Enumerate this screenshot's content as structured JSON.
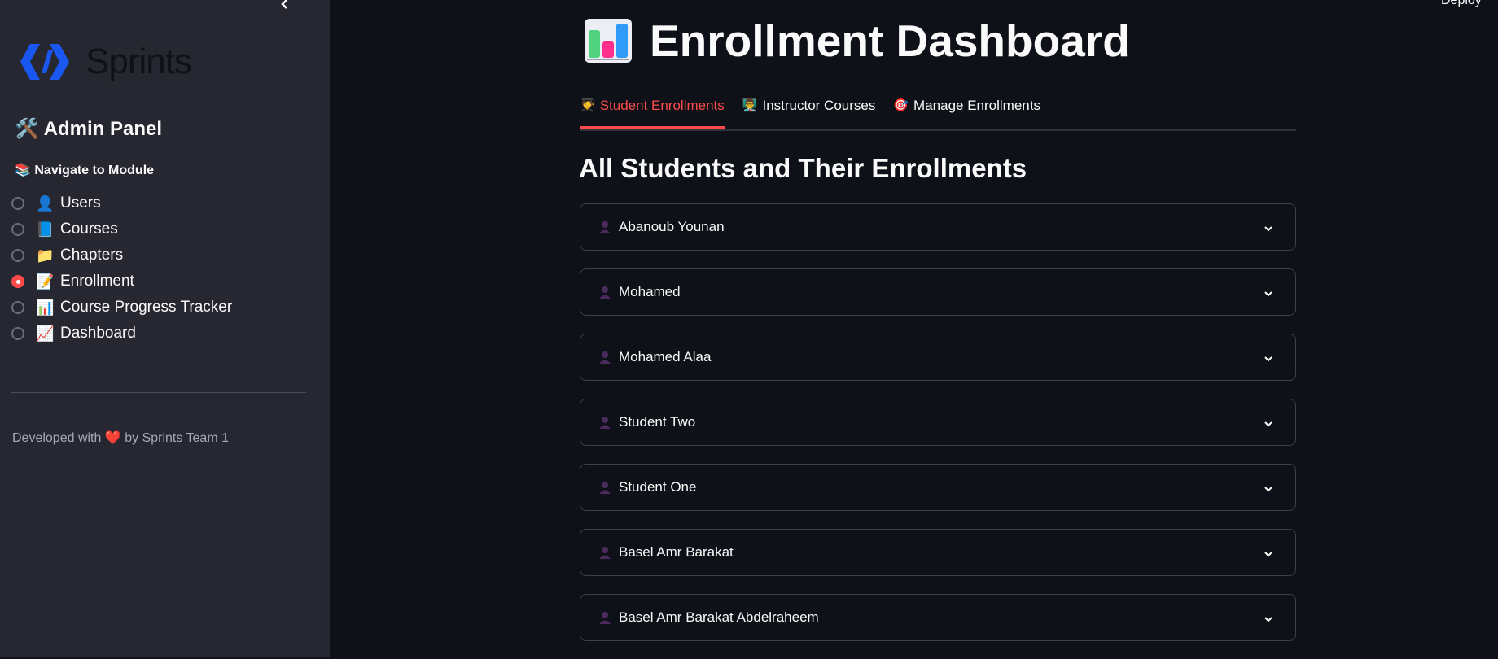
{
  "sidebar": {
    "collapse_icon": "chevron-left-icon",
    "logo_text": "Sprints",
    "panel_title": "🛠️ Admin Panel",
    "nav_label": "📚 Navigate to Module",
    "items": [
      {
        "emoji": "👤",
        "label": "Users",
        "selected": false
      },
      {
        "emoji": "📘",
        "label": "Courses",
        "selected": false
      },
      {
        "emoji": "📁",
        "label": "Chapters",
        "selected": false
      },
      {
        "emoji": "📝",
        "label": "Enrollment",
        "selected": true
      },
      {
        "emoji": "📊",
        "label": "Course Progress Tracker",
        "selected": false
      },
      {
        "emoji": "📈",
        "label": "Dashboard",
        "selected": false
      }
    ],
    "footer_prefix": "Developed with",
    "footer_heart": "❤️",
    "footer_suffix": "by Sprints Team 1"
  },
  "header": {
    "deploy_label": "Deploy"
  },
  "main": {
    "title_icon": "bar-chart-icon",
    "title": "Enrollment Dashboard",
    "tabs": [
      {
        "emoji": "🧑‍🎓",
        "label": "Student Enrollments",
        "active": true
      },
      {
        "emoji": "👨‍🏫",
        "label": "Instructor Courses",
        "active": false
      },
      {
        "emoji": "🎯",
        "label": "Manage Enrollments",
        "active": false
      }
    ],
    "section_title": "All Students and Their Enrollments",
    "students": [
      "Abanoub Younan",
      "Mohamed",
      "Mohamed Alaa",
      "Student Two",
      "Student One",
      "Basel Amr Barakat",
      "Basel Amr Barakat Abdelraheem"
    ]
  },
  "colors": {
    "accent": "#ff4b4b",
    "background": "#0e1117",
    "sidebar": "#262730",
    "brand_blue": "#1a56f0"
  }
}
